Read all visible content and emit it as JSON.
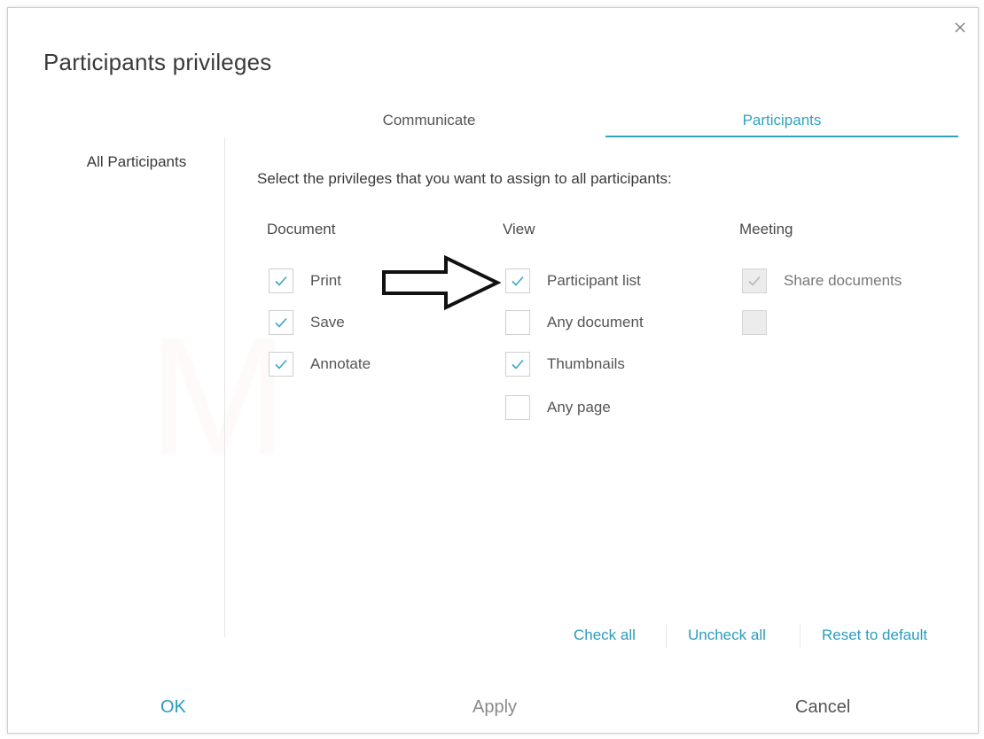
{
  "dialog": {
    "title": "Participants privileges",
    "watermark_letter": "M"
  },
  "tabs": [
    {
      "label": "Communicate",
      "active": false
    },
    {
      "label": "Participants",
      "active": true
    }
  ],
  "sidebar": {
    "items": [
      {
        "label": "All Participants"
      }
    ]
  },
  "main": {
    "instruction": "Select the privileges that you want to assign to all participants:",
    "columns": {
      "document": {
        "heading": "Document",
        "items": [
          {
            "label": "Print",
            "checked": true
          },
          {
            "label": "Save",
            "checked": true
          },
          {
            "label": "Annotate",
            "checked": true
          }
        ]
      },
      "view": {
        "heading": "View",
        "items": [
          {
            "label": "Participant list",
            "checked": true
          },
          {
            "label": "Any document",
            "checked": false
          },
          {
            "label": "Thumbnails",
            "checked": true
          },
          {
            "label": "Any page",
            "checked": false
          }
        ]
      },
      "meeting": {
        "heading": "Meeting",
        "items": [
          {
            "label": "Share documents",
            "checked": true,
            "disabled": true
          },
          {
            "label": "",
            "checked": false,
            "disabled": true
          }
        ]
      }
    }
  },
  "links": {
    "check_all": "Check all",
    "uncheck_all": "Uncheck all",
    "reset_to_default": "Reset to default"
  },
  "buttons": {
    "ok": "OK",
    "apply": "Apply",
    "cancel": "Cancel"
  },
  "colors": {
    "accent": "#2fa3bf",
    "link": "#2a9cbc",
    "check": "#3aa6c8",
    "disabled_check": "#b5b5b5"
  },
  "icons": {
    "close": "close-icon",
    "check": "checkmark-icon",
    "arrow": "right-arrow-icon"
  }
}
